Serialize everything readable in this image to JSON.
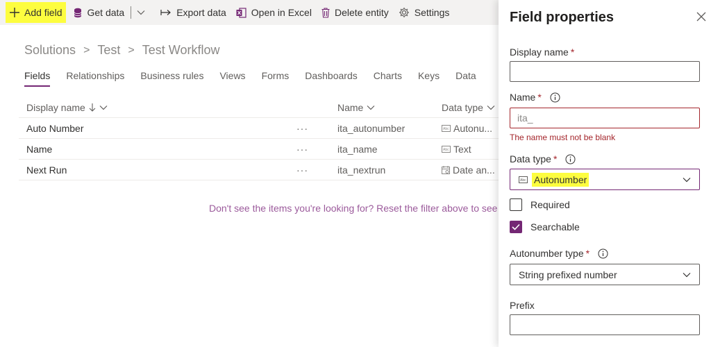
{
  "toolbar": {
    "add_field": "Add field",
    "get_data": "Get data",
    "export_data": "Export data",
    "open_in_excel": "Open in Excel",
    "delete_entity": "Delete entity",
    "settings": "Settings",
    "highlight_color": "#fdfd3f"
  },
  "breadcrumb": {
    "items": [
      "Solutions",
      "Test",
      "Test Workflow"
    ],
    "separator": ">"
  },
  "tabs": [
    "Fields",
    "Relationships",
    "Business rules",
    "Views",
    "Forms",
    "Dashboards",
    "Charts",
    "Keys",
    "Data"
  ],
  "grid": {
    "columns": {
      "display_name": "Display name",
      "name": "Name",
      "data_type": "Data type"
    },
    "more_label": "···",
    "rows": [
      {
        "display_name": "Auto Number",
        "name": "ita_autonumber",
        "data_type": "Autonu...",
        "type_icon": "autonumber-icon"
      },
      {
        "display_name": "Name",
        "name": "ita_name",
        "data_type": "Text",
        "type_icon": "text-icon"
      },
      {
        "display_name": "Next Run",
        "name": "ita_nextrun",
        "data_type": "Date an...",
        "type_icon": "calendar-icon"
      }
    ],
    "empty_message": "Don't see the items you're looking for? Reset the filter above to see more"
  },
  "panel": {
    "title": "Field properties",
    "display_name_label": "Display name",
    "display_name_value": "",
    "name_label": "Name",
    "name_value": "ita_",
    "name_error": "The name must not be blank",
    "data_type_label": "Data type",
    "data_type_value": "Autonumber",
    "required_label": "Required",
    "required_checked": false,
    "searchable_label": "Searchable",
    "searchable_checked": true,
    "autonumber_type_label": "Autonumber type",
    "autonumber_type_value": "String prefixed number",
    "prefix_label": "Prefix",
    "prefix_value": "",
    "required_marker": "*"
  },
  "colors": {
    "accent": "#742774",
    "error": "#a4262c",
    "highlight": "#fdfd3f"
  }
}
